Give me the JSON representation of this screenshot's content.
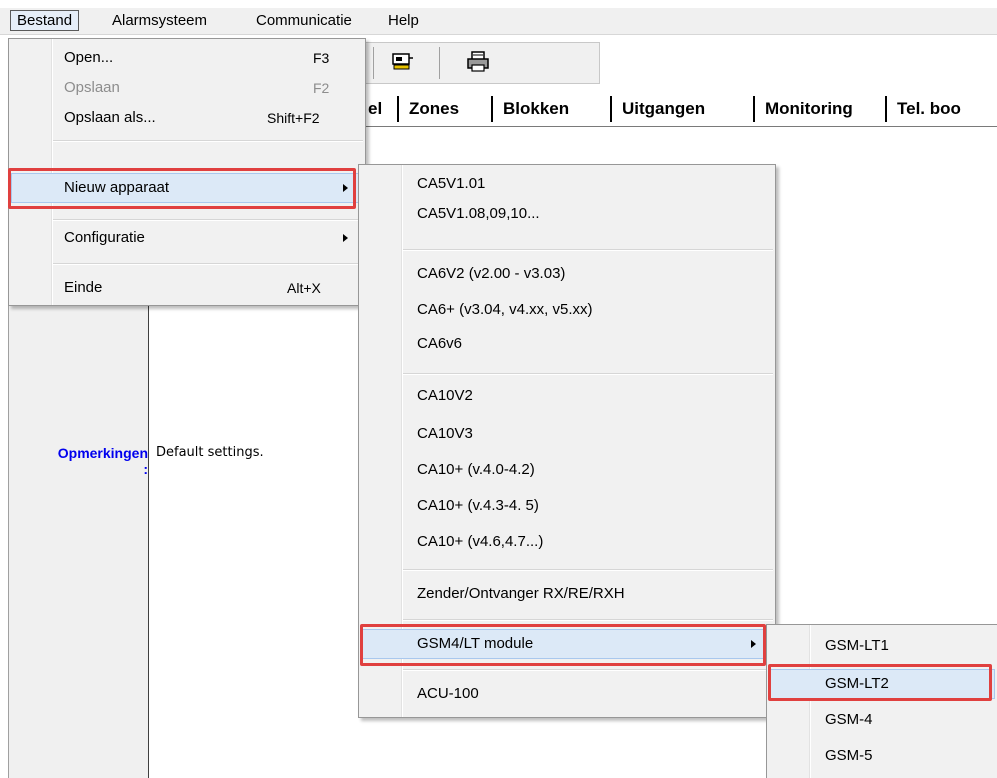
{
  "menubar": {
    "items": [
      "Bestand",
      "Alarmsysteem",
      "Communicatie",
      "Help"
    ]
  },
  "tabs": [
    "el",
    "Zones",
    "Blokken",
    "Uitgangen",
    "Monitoring",
    "Tel. boo"
  ],
  "content": {
    "remarks_label": "Opmerkingen",
    "remarks_colon": ":",
    "remarks_value": "Default settings."
  },
  "file_menu": {
    "open": {
      "label": "Open...",
      "key": "F3"
    },
    "save": {
      "label": "Opslaan",
      "key": "F2"
    },
    "save_as": {
      "label": "Opslaan als...",
      "key": "Shift+F2"
    },
    "new_device": {
      "label": "Nieuw apparaat"
    },
    "configuration": {
      "label": "Configuratie"
    },
    "exit": {
      "label": "Einde",
      "key": "Alt+X"
    }
  },
  "device_menu": {
    "items": [
      "CA5V1.01",
      "CA5V1.08,09,10...",
      "CA6V2 (v2.00 - v3.03)",
      "CA6+ (v3.04, v4.xx, v5.xx)",
      "CA6v6",
      "CA10V2",
      "CA10V3",
      "CA10+ (v.4.0-4.2)",
      "CA10+ (v.4.3-4. 5)",
      "CA10+ (v4.6,4.7...)",
      "Zender/Ontvanger RX/RE/RXH",
      "GSM4/LT module",
      "ACU-100"
    ]
  },
  "gsm_menu": {
    "items": [
      "GSM-LT1",
      "GSM-LT2",
      "GSM-4",
      "GSM-5"
    ]
  },
  "colors": {
    "highlight_box": "#e0403f",
    "link_blue": "#0000ee"
  }
}
